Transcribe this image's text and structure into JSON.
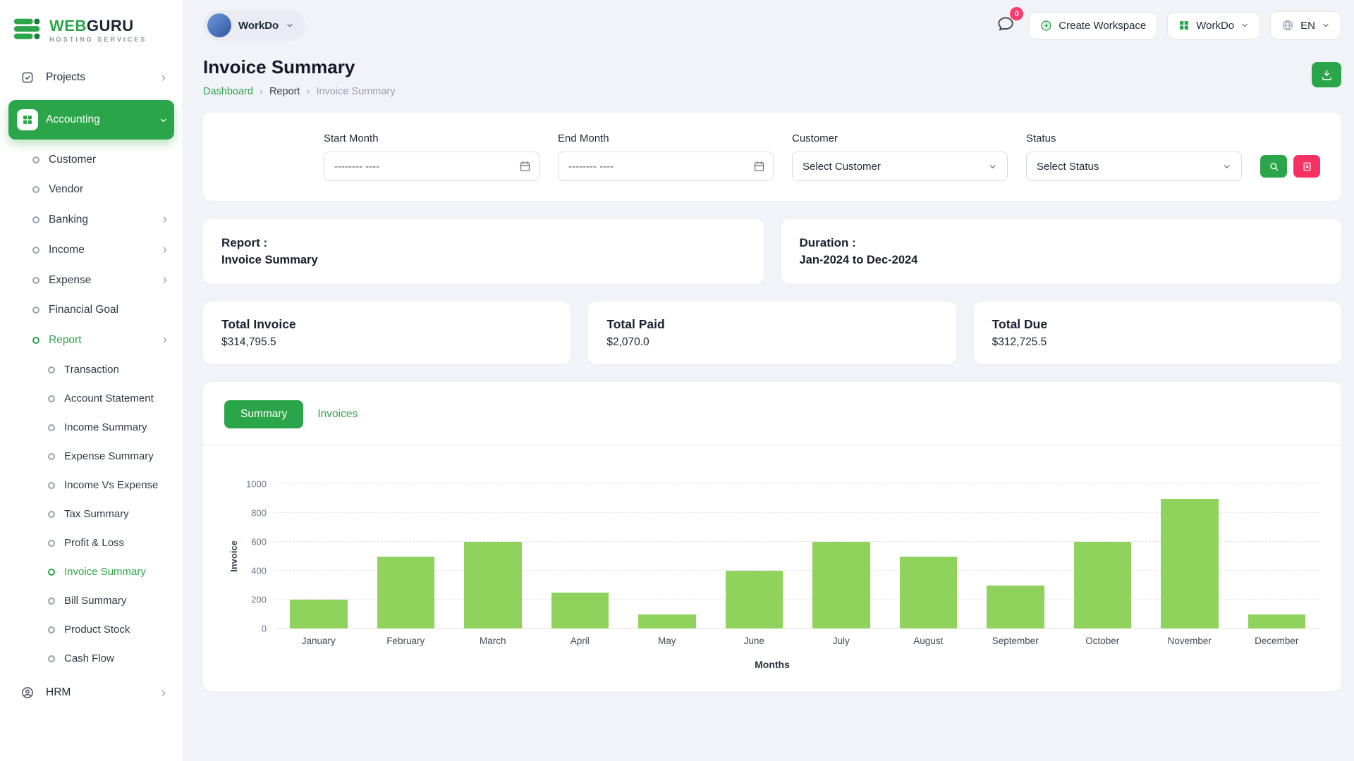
{
  "brand": {
    "name_primary": "WEB",
    "name_secondary": "GURU",
    "tagline": "HOSTING SERVICES"
  },
  "header": {
    "workspace_switcher": "WorkDo",
    "chat_badge": "0",
    "create_workspace_label": "Create Workspace",
    "apps_menu_label": "WorkDo",
    "language_code": "EN"
  },
  "page": {
    "title": "Invoice Summary",
    "breadcrumb_home": "Dashboard",
    "breadcrumb_section": "Report",
    "breadcrumb_current": "Invoice Summary"
  },
  "sidebar": {
    "projects_label": "Projects",
    "accounting_label": "Accounting",
    "hrm_label": "HRM",
    "accounting_items": [
      {
        "label": "Customer"
      },
      {
        "label": "Vendor"
      },
      {
        "label": "Banking"
      },
      {
        "label": "Income"
      },
      {
        "label": "Expense"
      },
      {
        "label": "Financial Goal"
      },
      {
        "label": "Report"
      }
    ],
    "report_items": [
      {
        "label": "Transaction"
      },
      {
        "label": "Account Statement"
      },
      {
        "label": "Income Summary"
      },
      {
        "label": "Expense Summary"
      },
      {
        "label": "Income Vs Expense"
      },
      {
        "label": "Tax Summary"
      },
      {
        "label": "Profit & Loss"
      },
      {
        "label": "Invoice Summary"
      },
      {
        "label": "Bill Summary"
      },
      {
        "label": "Product Stock"
      },
      {
        "label": "Cash Flow"
      }
    ]
  },
  "filters": {
    "start_month_label": "Start Month",
    "end_month_label": "End Month",
    "customer_label": "Customer",
    "status_label": "Status",
    "month_placeholder": "-------- ----",
    "customer_value": "Select Customer",
    "status_value": "Select Status"
  },
  "report_card": {
    "label": "Report :",
    "value": "Invoice Summary"
  },
  "duration_card": {
    "label": "Duration :",
    "value": "Jan-2024 to Dec-2024"
  },
  "stats": [
    {
      "label": "Total Invoice",
      "value": "$314,795.5"
    },
    {
      "label": "Total Paid",
      "value": "$2,070.0"
    },
    {
      "label": "Total Due",
      "value": "$312,725.5"
    }
  ],
  "tabs": {
    "summary": "Summary",
    "invoices": "Invoices"
  },
  "chart_data": {
    "type": "bar",
    "title": "",
    "categories": [
      "January",
      "February",
      "March",
      "April",
      "May",
      "June",
      "July",
      "August",
      "September",
      "October",
      "November",
      "December"
    ],
    "series": [
      {
        "name": "Invoice",
        "values": [
          200,
          500,
          600,
          250,
          100,
          400,
          600,
          500,
          300,
          600,
          900,
          100
        ]
      }
    ],
    "xlabel": "Months",
    "ylabel": "Invoice",
    "ylim": [
      0,
      1000
    ],
    "yticks": [
      0,
      200,
      400,
      600,
      800,
      1000
    ],
    "grid": "dashed-horizontal",
    "legend": "none",
    "bar_color": "#8fd35c"
  },
  "colors": {
    "primary_green": "#2ba549",
    "bar_green": "#8fd35c",
    "danger_pink": "#f73164",
    "badge_red": "#ff3a6e"
  }
}
